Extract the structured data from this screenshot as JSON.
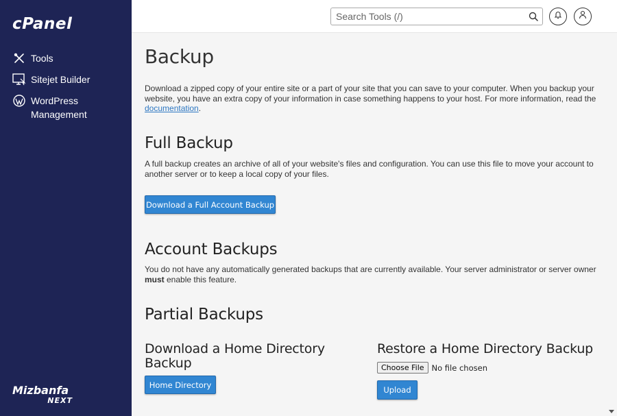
{
  "sidebar": {
    "logo": "cPanel",
    "items": [
      {
        "label": "Tools",
        "icon": "tools-icon"
      },
      {
        "label": "Sitejet Builder",
        "icon": "monitor-icon"
      },
      {
        "label": "WordPress Management",
        "icon": "wordpress-icon"
      }
    ],
    "brand_top": "Mizbanfa",
    "brand_bottom": "NEXT"
  },
  "topbar": {
    "search_placeholder": "Search Tools (/)"
  },
  "page": {
    "title": "Backup",
    "intro_text": "Download a zipped copy of your entire site or a part of your site that you can save to your computer. When you backup your website, you have an extra copy of your information in case something happens to your host. For more information, read the ",
    "intro_link": "documentation",
    "intro_end": "."
  },
  "full_backup": {
    "heading": "Full Backup",
    "text": "A full backup creates an archive of all of your website's files and configuration. You can use this file to move your account to another server or to keep a local copy of your files.",
    "button": "Download a Full Account Backup"
  },
  "account_backups": {
    "heading": "Account Backups",
    "text_before": "You do not have any automatically generated backups that are currently available. Your server administrator or server owner ",
    "text_bold": "must",
    "text_after": " enable this feature."
  },
  "partial_backups": {
    "heading": "Partial Backups",
    "download_heading": "Download a Home Directory Backup",
    "download_button": "Home Directory",
    "restore_heading": "Restore a Home Directory Backup",
    "choose_file_label": "Choose File",
    "file_status": "No file chosen",
    "upload_button": "Upload"
  }
}
